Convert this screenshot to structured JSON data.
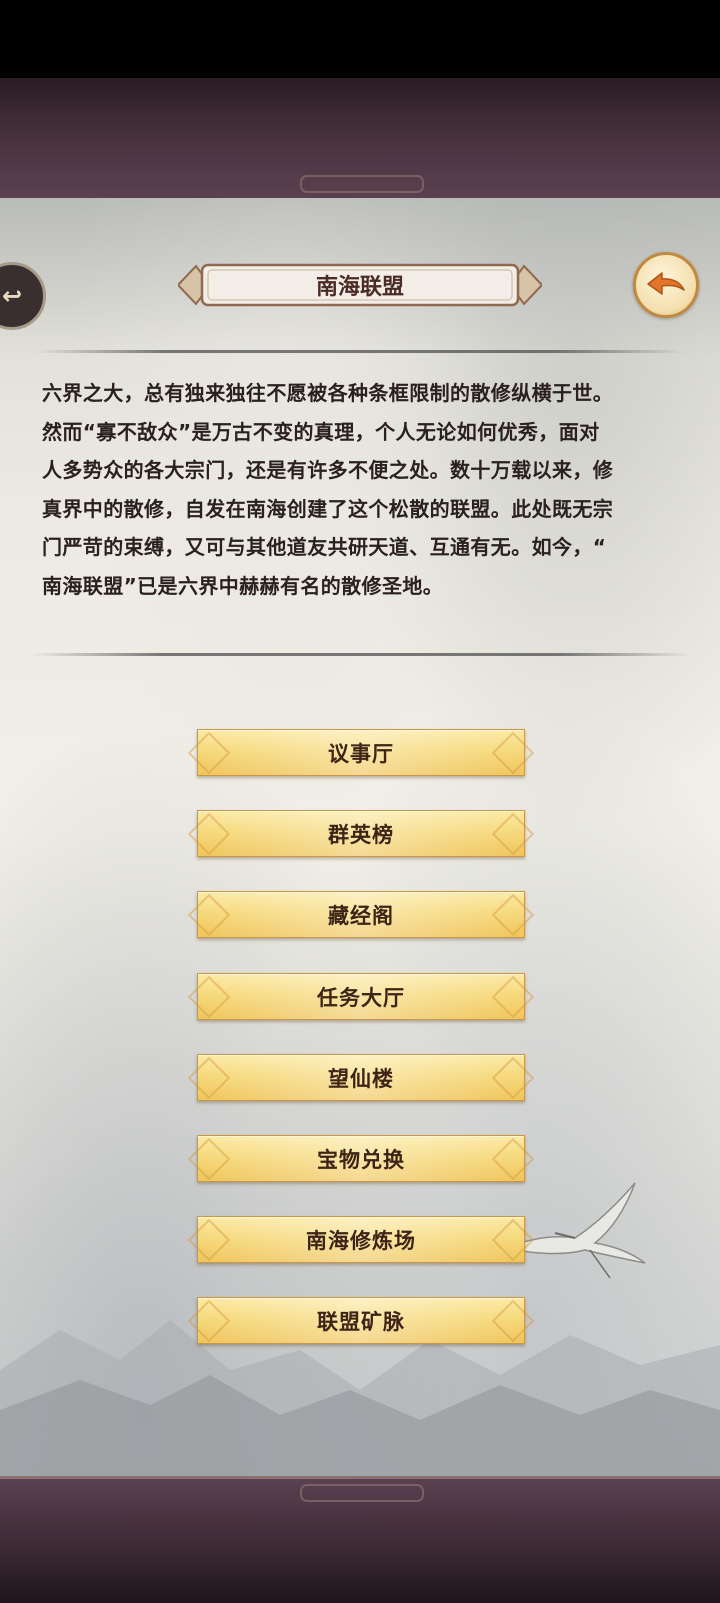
{
  "header": {
    "title": "南海联盟",
    "back_icon": "back-arrow-icon",
    "side_icon": "return-icon"
  },
  "description": [
    "六界之大，总有独来独往不愿被各种条框限制的散修纵横于世。",
    "然而“寡不敌众”是万古不变的真理，个人无论如何优秀，面对",
    "人多势众的各大宗门，还是有许多不便之处。数十万载以来，修",
    "真界中的散修，自发在南海创建了这个松散的联盟。此处既无宗",
    "门严苛的束缚，又可与其他道友共研天道、互通有无。如今，“",
    "南海联盟”已是六界中赫赫有名的散修圣地。"
  ],
  "menu": {
    "items": [
      {
        "label": "议事厅"
      },
      {
        "label": "群英榜"
      },
      {
        "label": "藏经阁"
      },
      {
        "label": "任务大厅"
      },
      {
        "label": "望仙楼"
      },
      {
        "label": "宝物兑换"
      },
      {
        "label": "南海修炼场"
      },
      {
        "label": "联盟矿脉"
      }
    ]
  },
  "colors": {
    "button_gold": "#f6d97b",
    "title_text": "#4a2c25",
    "frame": "#4a3440"
  }
}
